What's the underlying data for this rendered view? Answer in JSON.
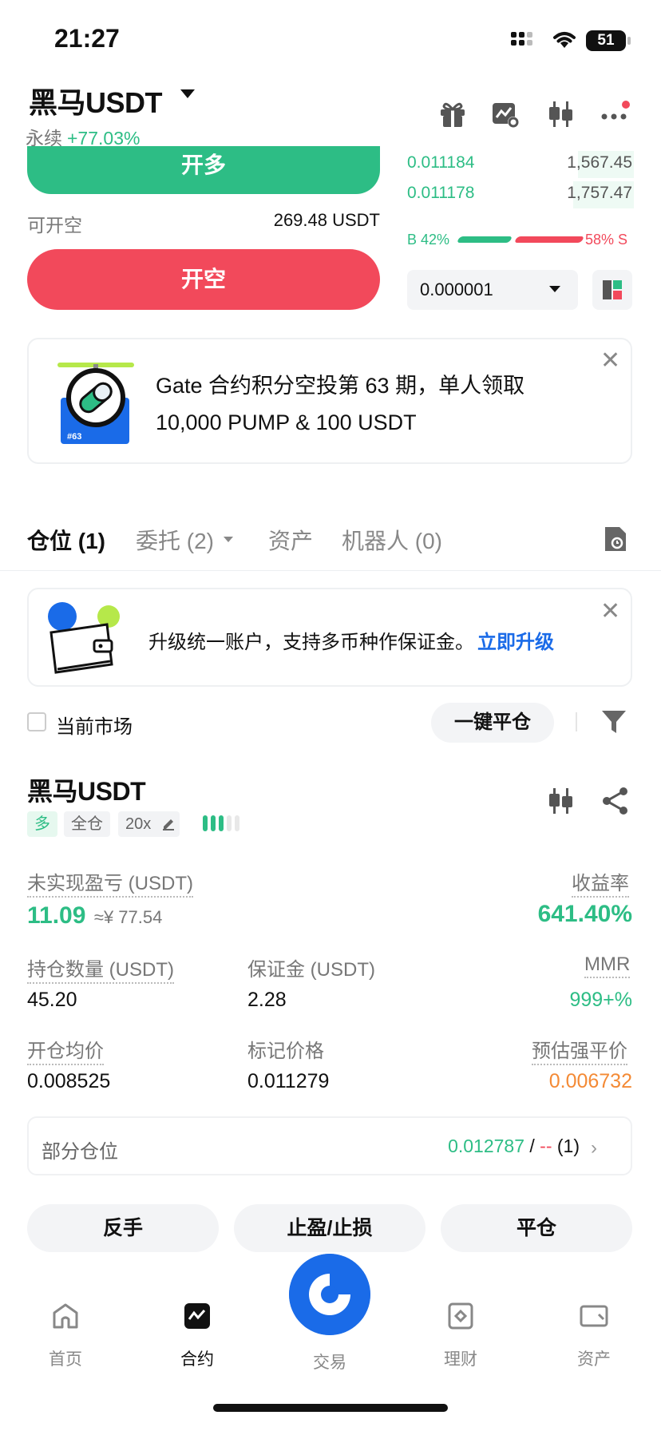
{
  "status_bar": {
    "time": "21:27",
    "battery": "51"
  },
  "header": {
    "pair": "黑马USDT",
    "contract_type": "永续",
    "change_pct": "+77.03%",
    "icons": [
      "gift-icon",
      "chart-settings-icon",
      "candlestick-icon",
      "more-icon"
    ]
  },
  "order_form": {
    "long_label": "开多",
    "can_short_label": "可开空",
    "can_short_value": "269.48 USDT",
    "short_label": "开空"
  },
  "order_book": {
    "rows": [
      {
        "price": "0.011184",
        "qty": "1,567.45"
      },
      {
        "price": "0.011178",
        "qty": "1,757.47"
      }
    ],
    "buy_ratio": "B 42%",
    "sell_ratio": "58% S",
    "precision": "0.000001"
  },
  "promo": {
    "badge": "#63",
    "line1": "Gate 合约积分空投第 63 期，单人领取",
    "line2": "10,000 PUMP & 100 USDT"
  },
  "tabs": [
    {
      "label": "仓位 (1)"
    },
    {
      "label": "委托 (2)"
    },
    {
      "label": "资产"
    },
    {
      "label": "机器人 (0)"
    }
  ],
  "upgrade_banner": {
    "text": "升级统一账户，支持多币种作保证金。",
    "link": "立即升级"
  },
  "filters": {
    "current_market": "当前市场",
    "close_all": "一键平仓"
  },
  "position": {
    "pair": "黑马USDT",
    "side": "多",
    "margin_mode": "全仓",
    "leverage": "20x",
    "risk_level_bars": 3,
    "unrealized_pnl_label": "未实现盈亏 (USDT)",
    "unrealized_pnl": "11.09",
    "unrealized_pnl_cny": "≈¥ 77.54",
    "roe_label": "收益率",
    "roe": "641.40%",
    "size_label": "持仓数量 (USDT)",
    "size": "45.20",
    "margin_label": "保证金 (USDT)",
    "margin": "2.28",
    "mmr_label": "MMR",
    "mmr": "999+%",
    "entry_label": "开仓均价",
    "entry": "0.008525",
    "mark_label": "标记价格",
    "mark": "0.011279",
    "liq_label": "预估强平价",
    "liq": "0.006732",
    "partial_label": "部分仓位",
    "partial_tp": "0.012787",
    "partial_sep": " / ",
    "partial_sl": "--",
    "partial_count": " (1)"
  },
  "actions": {
    "reverse": "反手",
    "tpsl": "止盈/止损",
    "close": "平仓"
  },
  "bottom_nav": [
    {
      "label": "首页"
    },
    {
      "label": "合约"
    },
    {
      "label": "交易"
    },
    {
      "label": "理财"
    },
    {
      "label": "资产"
    }
  ],
  "colors": {
    "green": "#2dbd85",
    "red": "#f2495b",
    "blue": "#1a6be8",
    "orange": "#f48a35"
  }
}
